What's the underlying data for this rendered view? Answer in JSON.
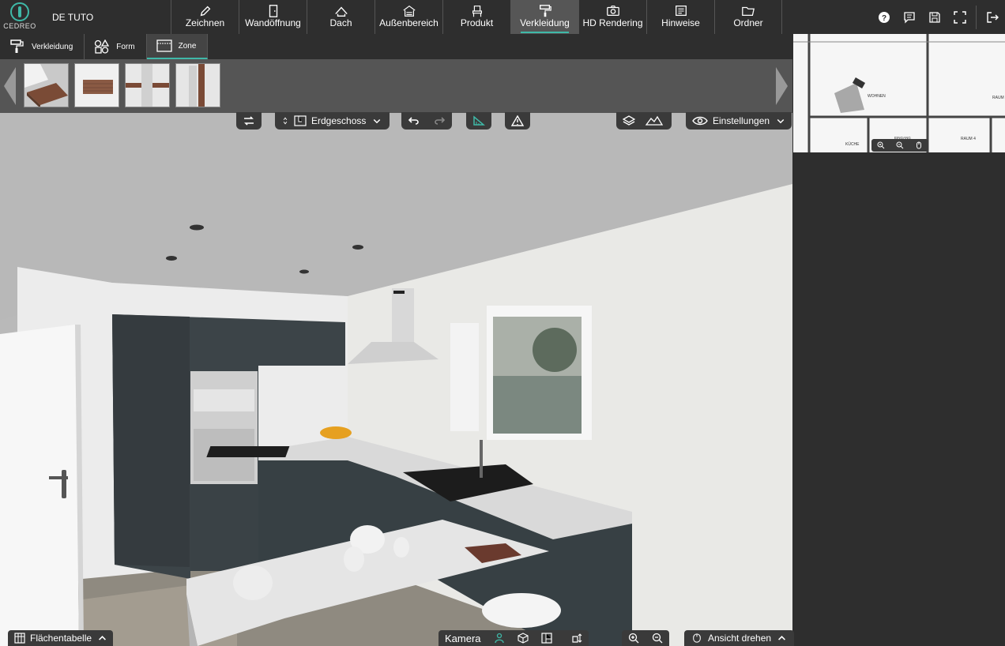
{
  "app": {
    "logo_text": "CEDREO",
    "project_name": "DE TUTO"
  },
  "menu": [
    {
      "label": "Zeichnen",
      "icon": "pencil-icon"
    },
    {
      "label": "Wandöffnung",
      "icon": "door-icon"
    },
    {
      "label": "Dach",
      "icon": "roof-icon"
    },
    {
      "label": "Außenbereich",
      "icon": "garden-icon"
    },
    {
      "label": "Produkt",
      "icon": "chair-icon"
    },
    {
      "label": "Verkleidung",
      "icon": "paint-roller-icon",
      "active": true
    },
    {
      "label": "HD Rendering",
      "icon": "camera-icon"
    },
    {
      "label": "Hinweise",
      "icon": "notes-icon"
    },
    {
      "label": "Ordner",
      "icon": "folder-icon"
    }
  ],
  "subtabs": [
    {
      "label": "Verkleidung",
      "icon": "paint-roller-icon"
    },
    {
      "label": "Form",
      "icon": "shapes-icon"
    },
    {
      "label": "Zone",
      "icon": "zone-icon",
      "active": true
    }
  ],
  "viewport_toolbar": {
    "floor_select": "Erdgeschoss",
    "settings_label": "Einstellungen"
  },
  "bottom": {
    "surface_table": "Flächentabelle",
    "camera_label": "Kamera",
    "rotate_label": "Ansicht drehen"
  },
  "minimap": {
    "rooms": [
      "WOHNEN",
      "RAUM",
      "KÜCHE",
      "RAUM 4",
      "EINGANG"
    ]
  },
  "colors": {
    "accent": "#3fb9a8",
    "bar": "#2e2e2e",
    "active_tab": "#565656"
  }
}
